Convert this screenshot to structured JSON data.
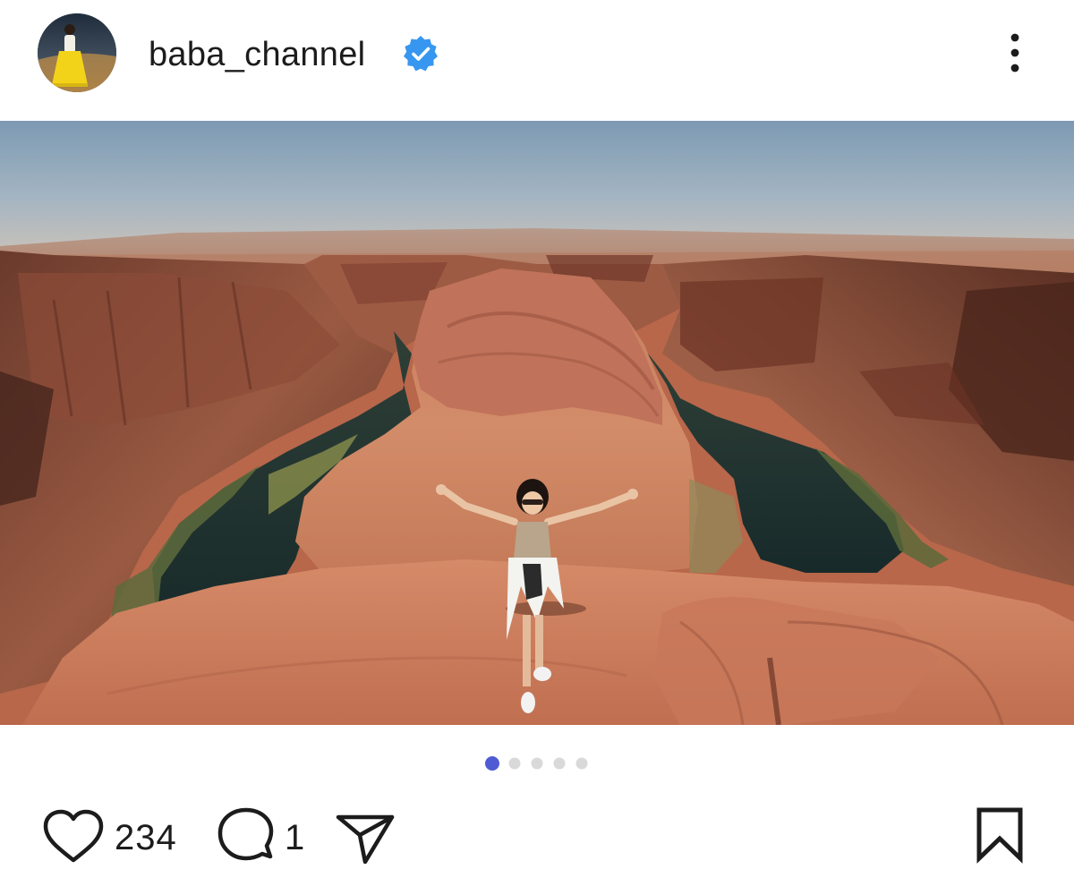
{
  "header": {
    "username": "baba_channel",
    "verified": true,
    "avatar_icon": "profile-photo",
    "more_icon": "more-vertical-icon"
  },
  "post": {
    "image_description_icon": "photo",
    "carousel": {
      "total": 5,
      "active_index": 0
    }
  },
  "actions": {
    "like_icon": "heart-icon",
    "like_count": "234",
    "comment_icon": "comment-icon",
    "comment_count": "1",
    "share_icon": "send-icon",
    "save_icon": "bookmark-icon"
  },
  "colors": {
    "verified_blue": "#3797f0",
    "active_dot": "#4f5bd5",
    "inactive_dot": "#d9d9d9",
    "text": "#1c1c1c"
  }
}
